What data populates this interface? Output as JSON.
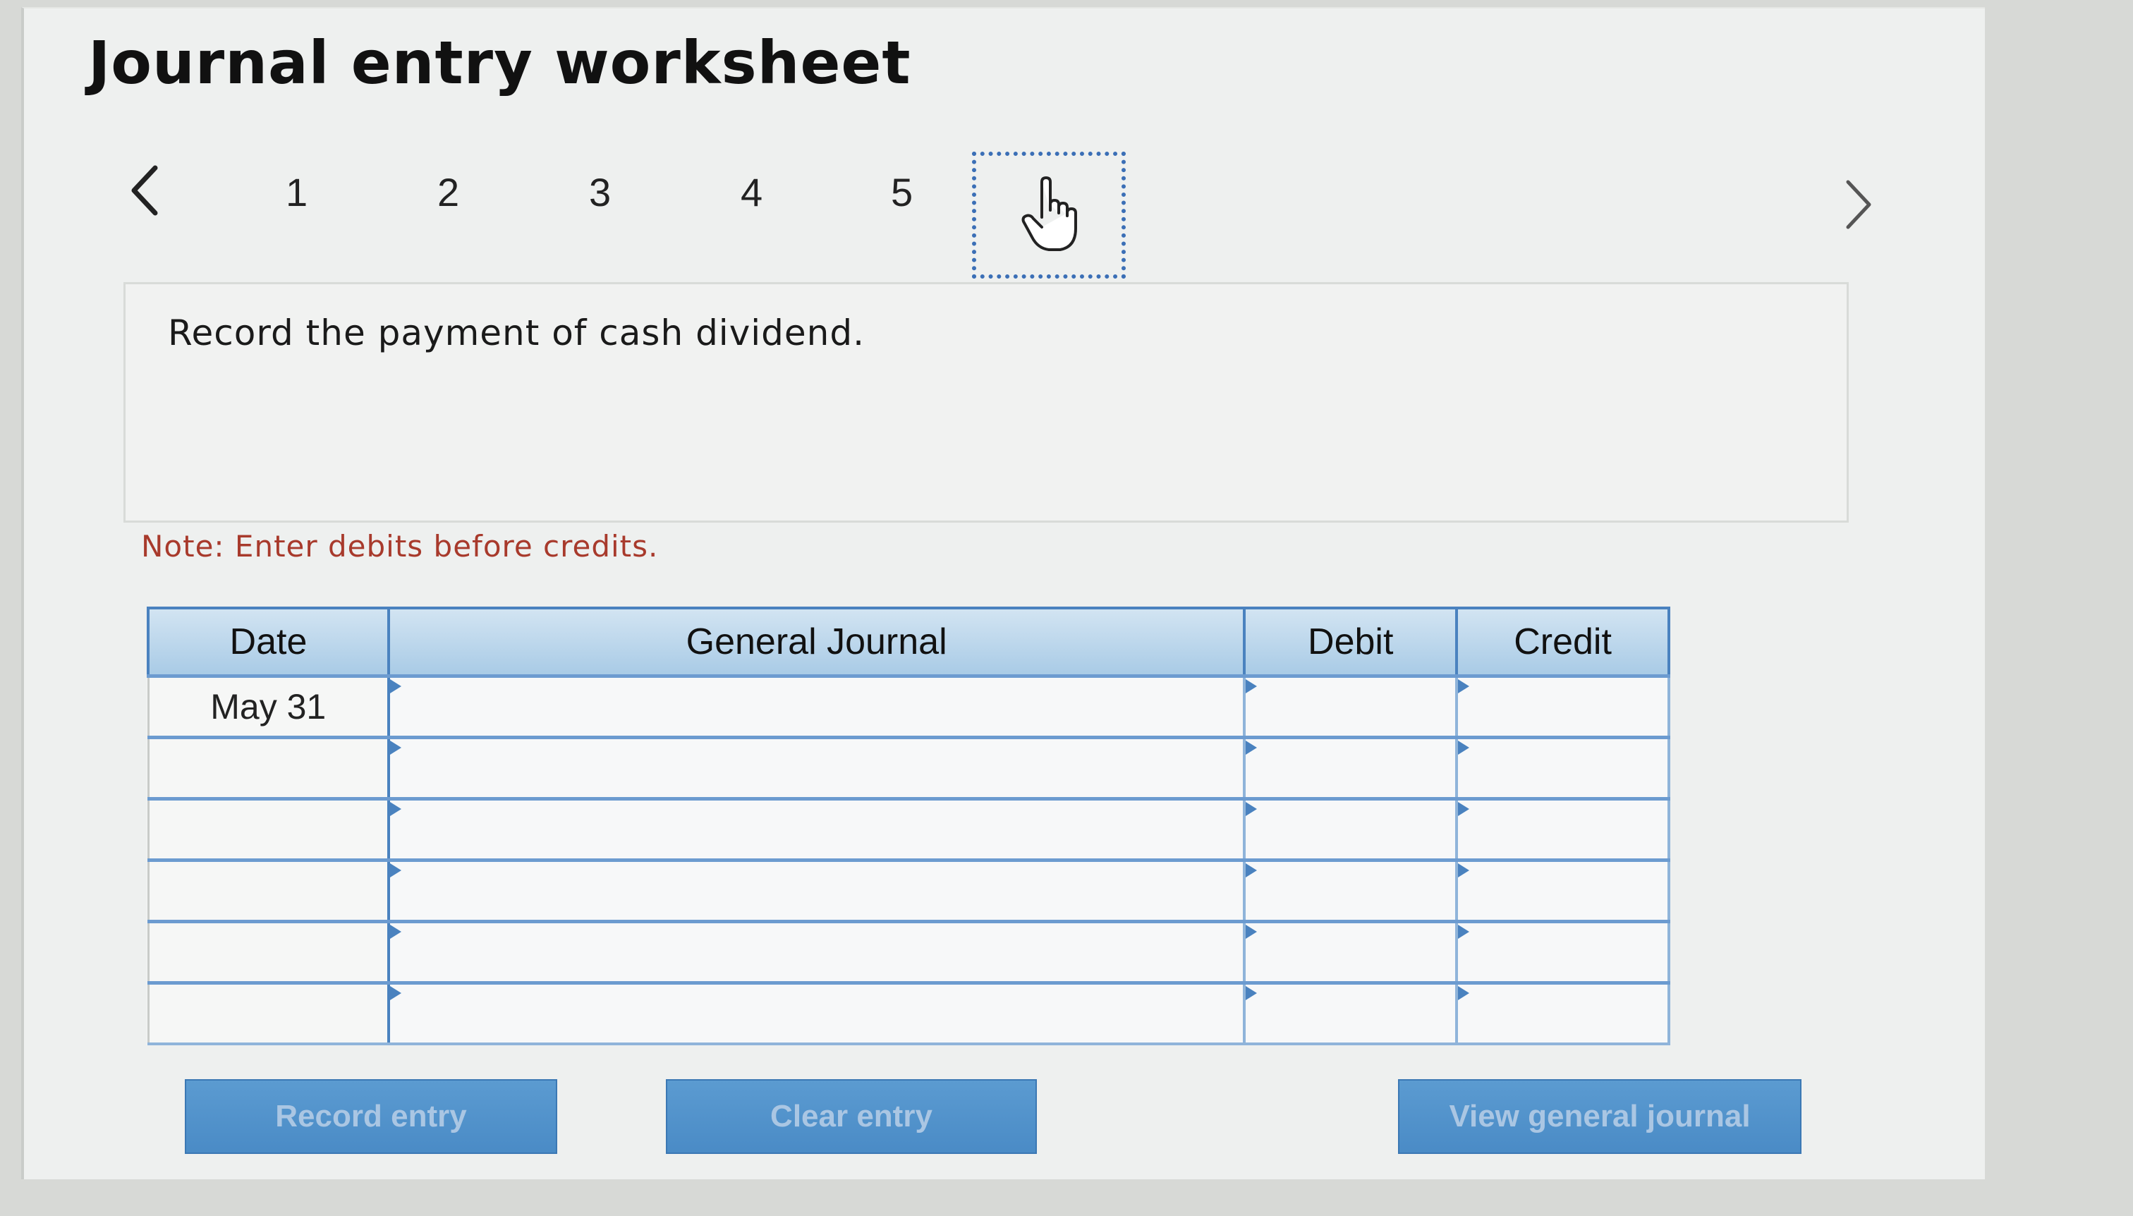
{
  "title": "Journal entry worksheet",
  "nav": {
    "prev_icon": "chevron-left-icon",
    "next_icon": "chevron-right-icon",
    "steps": [
      "1",
      "2",
      "3",
      "4",
      "5"
    ],
    "current_icon": "hand-pointer-icon"
  },
  "question": "Record the payment of cash dividend.",
  "note": "Note: Enter debits before credits.",
  "table": {
    "headers": {
      "date": "Date",
      "journal": "General Journal",
      "debit": "Debit",
      "credit": "Credit"
    },
    "rows": [
      {
        "date": "May 31",
        "journal": "",
        "debit": "",
        "credit": ""
      },
      {
        "date": "",
        "journal": "",
        "debit": "",
        "credit": ""
      },
      {
        "date": "",
        "journal": "",
        "debit": "",
        "credit": ""
      },
      {
        "date": "",
        "journal": "",
        "debit": "",
        "credit": ""
      },
      {
        "date": "",
        "journal": "",
        "debit": "",
        "credit": ""
      },
      {
        "date": "",
        "journal": "",
        "debit": "",
        "credit": ""
      }
    ]
  },
  "buttons": {
    "record": "Record entry",
    "clear": "Clear entry",
    "view": "View general journal"
  },
  "colors": {
    "accent": "#4a82bf",
    "button": "#5b9bd1",
    "note": "#a83a2c"
  }
}
